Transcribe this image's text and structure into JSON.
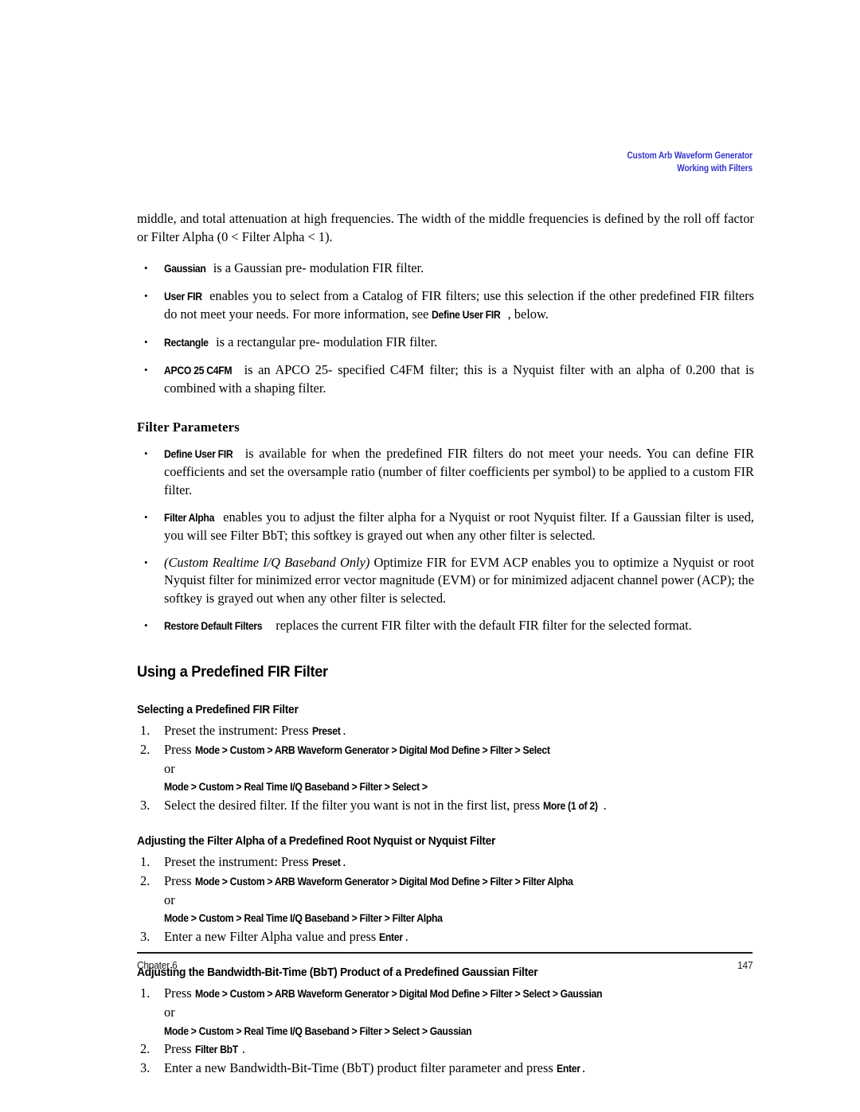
{
  "running_header": {
    "line1": "Custom Arb Waveform Generator",
    "line2": "Working with Filters",
    "color": "#3333cc"
  },
  "intro_paragraph": "middle, and total attenuation at high frequencies. The width of the middle frequencies is defined by the roll off factor or Filter Alpha (0 < Filter Alpha < 1).",
  "filter_bullets": [
    {
      "softkey": "Gaussian",
      "text": " is a Gaussian pre- modulation FIR filter."
    },
    {
      "softkey": "User FIR",
      "text_before": " enables you to select from a Catalog of FIR filters; use this selection if the other predefined FIR filters do not meet your needs. For more information, see ",
      "softkey2": "Define User FIR",
      "text_after": ", below."
    },
    {
      "softkey": "Rectangle",
      "text": " is a rectangular pre- modulation FIR filter."
    },
    {
      "softkey": "APCO 25 C4FM",
      "text": " is an APCO 25- specified C4FM filter; this is a Nyquist filter with an alpha of 0.200 that is combined with a shaping filter."
    }
  ],
  "filter_parameters_heading": "Filter Parameters",
  "parameter_bullets": [
    {
      "softkey": "Define User FIR",
      "text": " is available for when the predefined FIR filters do not meet your needs. You can define FIR coefficients and set the oversample ratio (number of filter coefficients per symbol) to be applied to a custom FIR filter."
    },
    {
      "softkey": "Filter Alpha",
      "text": " enables you to adjust the filter alpha for a Nyquist or root Nyquist filter. If a Gaussian filter is used, you will see Filter BbT; this softkey is grayed out when any other filter is selected."
    },
    {
      "italic": "(Custom Realtime I/Q Baseband Only)",
      "text": " Optimize FIR for EVM ACP enables you to optimize a Nyquist or root Nyquist filter for minimized error vector magnitude (EVM) or for minimized adjacent channel power (ACP); the softkey is grayed out when any other filter is selected."
    },
    {
      "softkey": "Restore Default Filters",
      "text": " replaces the current FIR filter with the default FIR filter for the selected format."
    }
  ],
  "section_heading": "Using a Predefined FIR Filter",
  "subsections": [
    {
      "heading": "Selecting a Predefined FIR Filter",
      "steps": [
        {
          "num": "1.",
          "pre": "Preset the instrument: Press ",
          "softkey": "Preset",
          "post": "."
        },
        {
          "num": "2.",
          "pre": "Press ",
          "softkey": "Mode  >  Custom  >  ARB Waveform Generator  >  Digital Mod Define  >  Filter  >  Select",
          "post": ""
        }
      ],
      "or_label": "or",
      "alt_path": "Mode  >  Custom  >  Real Time I/Q Baseband  >  Filter  >  Select  >",
      "last_step": {
        "num": "3.",
        "pre": "Select the desired filter. If the filter you want is not in the first list, press ",
        "softkey": "More (1 of 2)",
        "post": "."
      }
    },
    {
      "heading": "Adjusting the Filter Alpha of a Predefined Root Nyquist or Nyquist Filter",
      "steps": [
        {
          "num": "1.",
          "pre": "Preset the instrument: Press ",
          "softkey": "Preset",
          "post": "."
        },
        {
          "num": "2.",
          "pre": "Press ",
          "softkey": "Mode  >  Custom  >  ARB Waveform Generator  >  Digital Mod Define  >  Filter  >  Filter Alpha",
          "post": ""
        }
      ],
      "or_label": "or",
      "alt_path": "Mode  >  Custom  >  Real Time I/Q Baseband  >  Filter  >  Filter Alpha",
      "last_step": {
        "num": "3.",
        "pre": "Enter a new Filter Alpha value and press ",
        "softkey": "Enter",
        "post": "."
      }
    },
    {
      "heading": "Adjusting the Bandwidth-Bit-Time (BbT) Product of a Predefined Gaussian Filter",
      "steps": [
        {
          "num": "1.",
          "pre": "Press ",
          "softkey": "Mode  >  Custom  >  ARB Waveform Generator  >  Digital Mod Define  >  Filter  >  Select  >  Gaussian",
          "post": ""
        }
      ],
      "or_label": "or",
      "alt_path": "Mode  >  Custom  >  Real Time I/Q Baseband  >  Filter  >  Select  >  Gaussian",
      "step2": {
        "num": "2.",
        "pre": "Press ",
        "softkey": "Filter BbT",
        "post": "."
      },
      "last_step": {
        "num": "3.",
        "pre": "Enter a new Bandwidth-Bit-Time (BbT) product filter parameter and press ",
        "softkey": "Enter",
        "post": "."
      }
    }
  ],
  "footer": {
    "chapter": "Chpater 6",
    "page_number": "147"
  }
}
